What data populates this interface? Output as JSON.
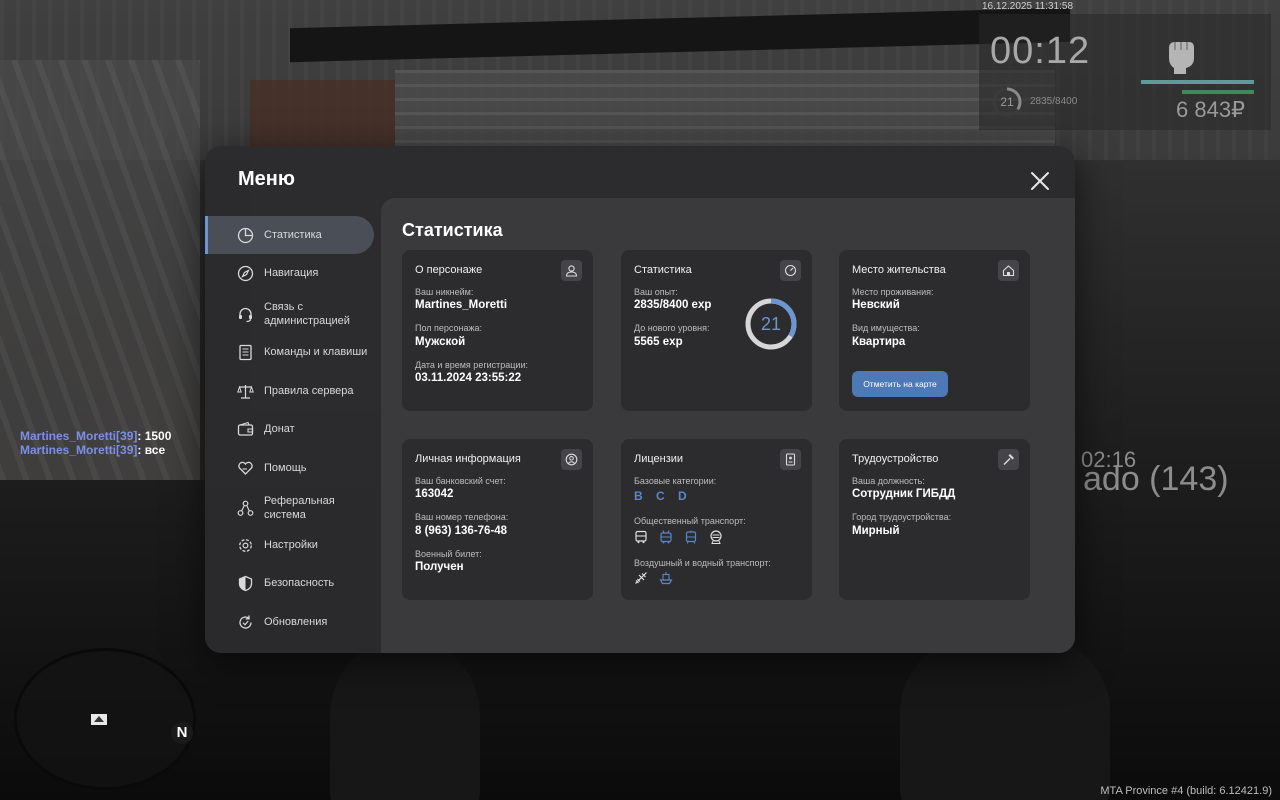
{
  "hud": {
    "datetime": "16.12.2025 11:31:58",
    "timer": "00:12",
    "level": "21",
    "exp": "2835/8400",
    "money": "6 843₽",
    "time2": "02:16",
    "label": "ado (143)"
  },
  "chat": [
    {
      "name": "Martines_Moretti[39]",
      "text": ": 1500"
    },
    {
      "name": "Martines_Moretti[39]",
      "text": ": все"
    }
  ],
  "minimap": {
    "north": "N"
  },
  "build": "MTA Province #4 (build: 6.12421.9)",
  "menu": {
    "title": "Меню",
    "content_title": "Статистика",
    "nav": [
      {
        "label": "Статистика",
        "icon": "pie-chart-icon"
      },
      {
        "label": "Навигация",
        "icon": "compass-icon"
      },
      {
        "label": "Связь с\nадминистрацией",
        "icon": "headset-icon"
      },
      {
        "label": "Команды и клавиши",
        "icon": "document-icon"
      },
      {
        "label": "Правила сервера",
        "icon": "scales-icon"
      },
      {
        "label": "Донат",
        "icon": "wallet-icon"
      },
      {
        "label": "Помощь",
        "icon": "heart-hand-icon"
      },
      {
        "label": "Реферальная\nсистема",
        "icon": "network-icon"
      },
      {
        "label": "Настройки",
        "icon": "gear-icon"
      },
      {
        "label": "Безопасность",
        "icon": "shield-icon"
      },
      {
        "label": "Обновления",
        "icon": "refresh-icon"
      }
    ],
    "cards": {
      "character": {
        "title": "О персонаже",
        "nick_label": "Ваш никнейм:",
        "nick": "Martines_Moretti",
        "gender_label": "Пол персонажа:",
        "gender": "Мужской",
        "reg_label": "Дата и время регистрации:",
        "reg": "03.11.2024 23:55:22"
      },
      "stats": {
        "title": "Статистика",
        "exp_label": "Ваш опыт:",
        "exp": "2835/8400 exp",
        "next_label": "До нового уровня:",
        "next": "5565 exp",
        "level": "21",
        "progress": 0.3375
      },
      "residence": {
        "title": "Место жительства",
        "place_label": "Место проживания:",
        "place": "Невский",
        "prop_label": "Вид имущества:",
        "prop": "Квартира",
        "button": "Отметить на карте"
      },
      "personal": {
        "title": "Личная информация",
        "bank_label": "Ваш банковский счет:",
        "bank": "163042",
        "phone_label": "Ваш номер телефона:",
        "phone": "8 (963) 136-76-48",
        "military_label": "Военный билет:",
        "military": "Получен"
      },
      "licenses": {
        "title": "Лицензии",
        "base_label": "Базовые категории:",
        "base": "B C D",
        "public_label": "Общественный транспорт:",
        "air_label": "Воздушный и водный транспорт:"
      },
      "job": {
        "title": "Трудоустройство",
        "position_label": "Ваша должность:",
        "position": "Сотрудник ГИБДД",
        "city_label": "Город трудоустройства:",
        "city": "Мирный"
      }
    }
  }
}
